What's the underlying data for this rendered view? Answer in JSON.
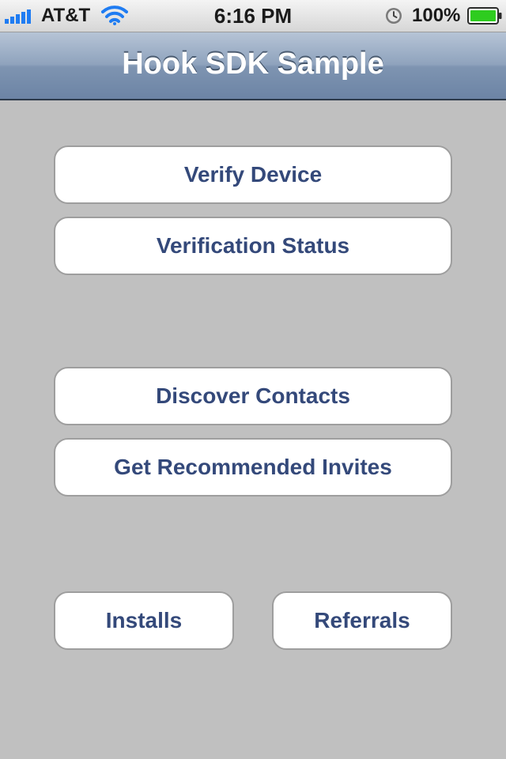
{
  "status_bar": {
    "carrier": "AT&T",
    "time": "6:16 PM",
    "battery_percent": "100%",
    "signal_bars": 5,
    "battery_level": 1.0,
    "battery_color": "#2ecc1f",
    "wifi_color": "#1f7cf2",
    "signal_color": "#1f7cf2"
  },
  "nav": {
    "title": "Hook SDK Sample"
  },
  "buttons": {
    "verify_device": "Verify Device",
    "verification_status": "Verification Status",
    "discover_contacts": "Discover Contacts",
    "recommended_invites": "Get Recommended Invites",
    "installs": "Installs",
    "referrals": "Referrals"
  },
  "colors": {
    "background": "#c0c0c0",
    "button_text": "#34497a",
    "nav_bar": "#6c84a5"
  }
}
